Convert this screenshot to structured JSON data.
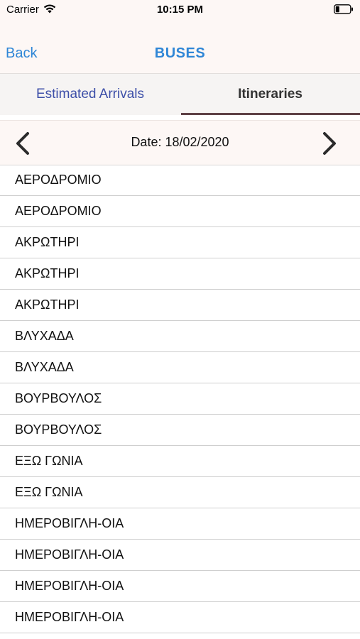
{
  "status_bar": {
    "carrier": "Carrier",
    "time": "10:15 PM",
    "icons": [
      "wifi-icon",
      "battery-icon"
    ]
  },
  "nav": {
    "back_label": "Back",
    "title": "BUSES"
  },
  "tabs": [
    {
      "label": "Estimated Arrivals",
      "selected": false
    },
    {
      "label": "Itineraries",
      "selected": true
    }
  ],
  "date_bar": {
    "label": "Date: 18/02/2020",
    "prev_icon": "chevron-left-icon",
    "next_icon": "chevron-right-icon"
  },
  "routes": [
    "ΑΕΡΟΔΡΟΜΙΟ",
    "ΑΕΡΟΔΡΟΜΙΟ",
    "ΑΚΡΩΤΗΡΙ",
    "ΑΚΡΩΤΗΡΙ",
    "ΑΚΡΩΤΗΡΙ",
    "ΒΛΥΧΑΔΑ",
    "ΒΛΥΧΑΔΑ",
    "ΒΟΥΡΒΟΥΛΟΣ",
    "ΒΟΥΡΒΟΥΛΟΣ",
    "ΕΞΩ ΓΩΝΙΑ",
    "ΕΞΩ ΓΩΝΙΑ",
    "ΗΜΕΡΟΒΙΓΛΗ-ΟΙΑ",
    "ΗΜΕΡΟΒΙΓΛΗ-ΟΙΑ",
    "ΗΜΕΡΟΒΙΓΛΗ-ΟΙΑ",
    "ΗΜΕΡΟΒΙΓΛΗ-ΟΙΑ"
  ],
  "colors": {
    "accent": "#2f86d6",
    "tab_inactive": "#3d4fa8",
    "tab_indicator": "#5e4146",
    "header_bg": "#fdf7f5"
  }
}
